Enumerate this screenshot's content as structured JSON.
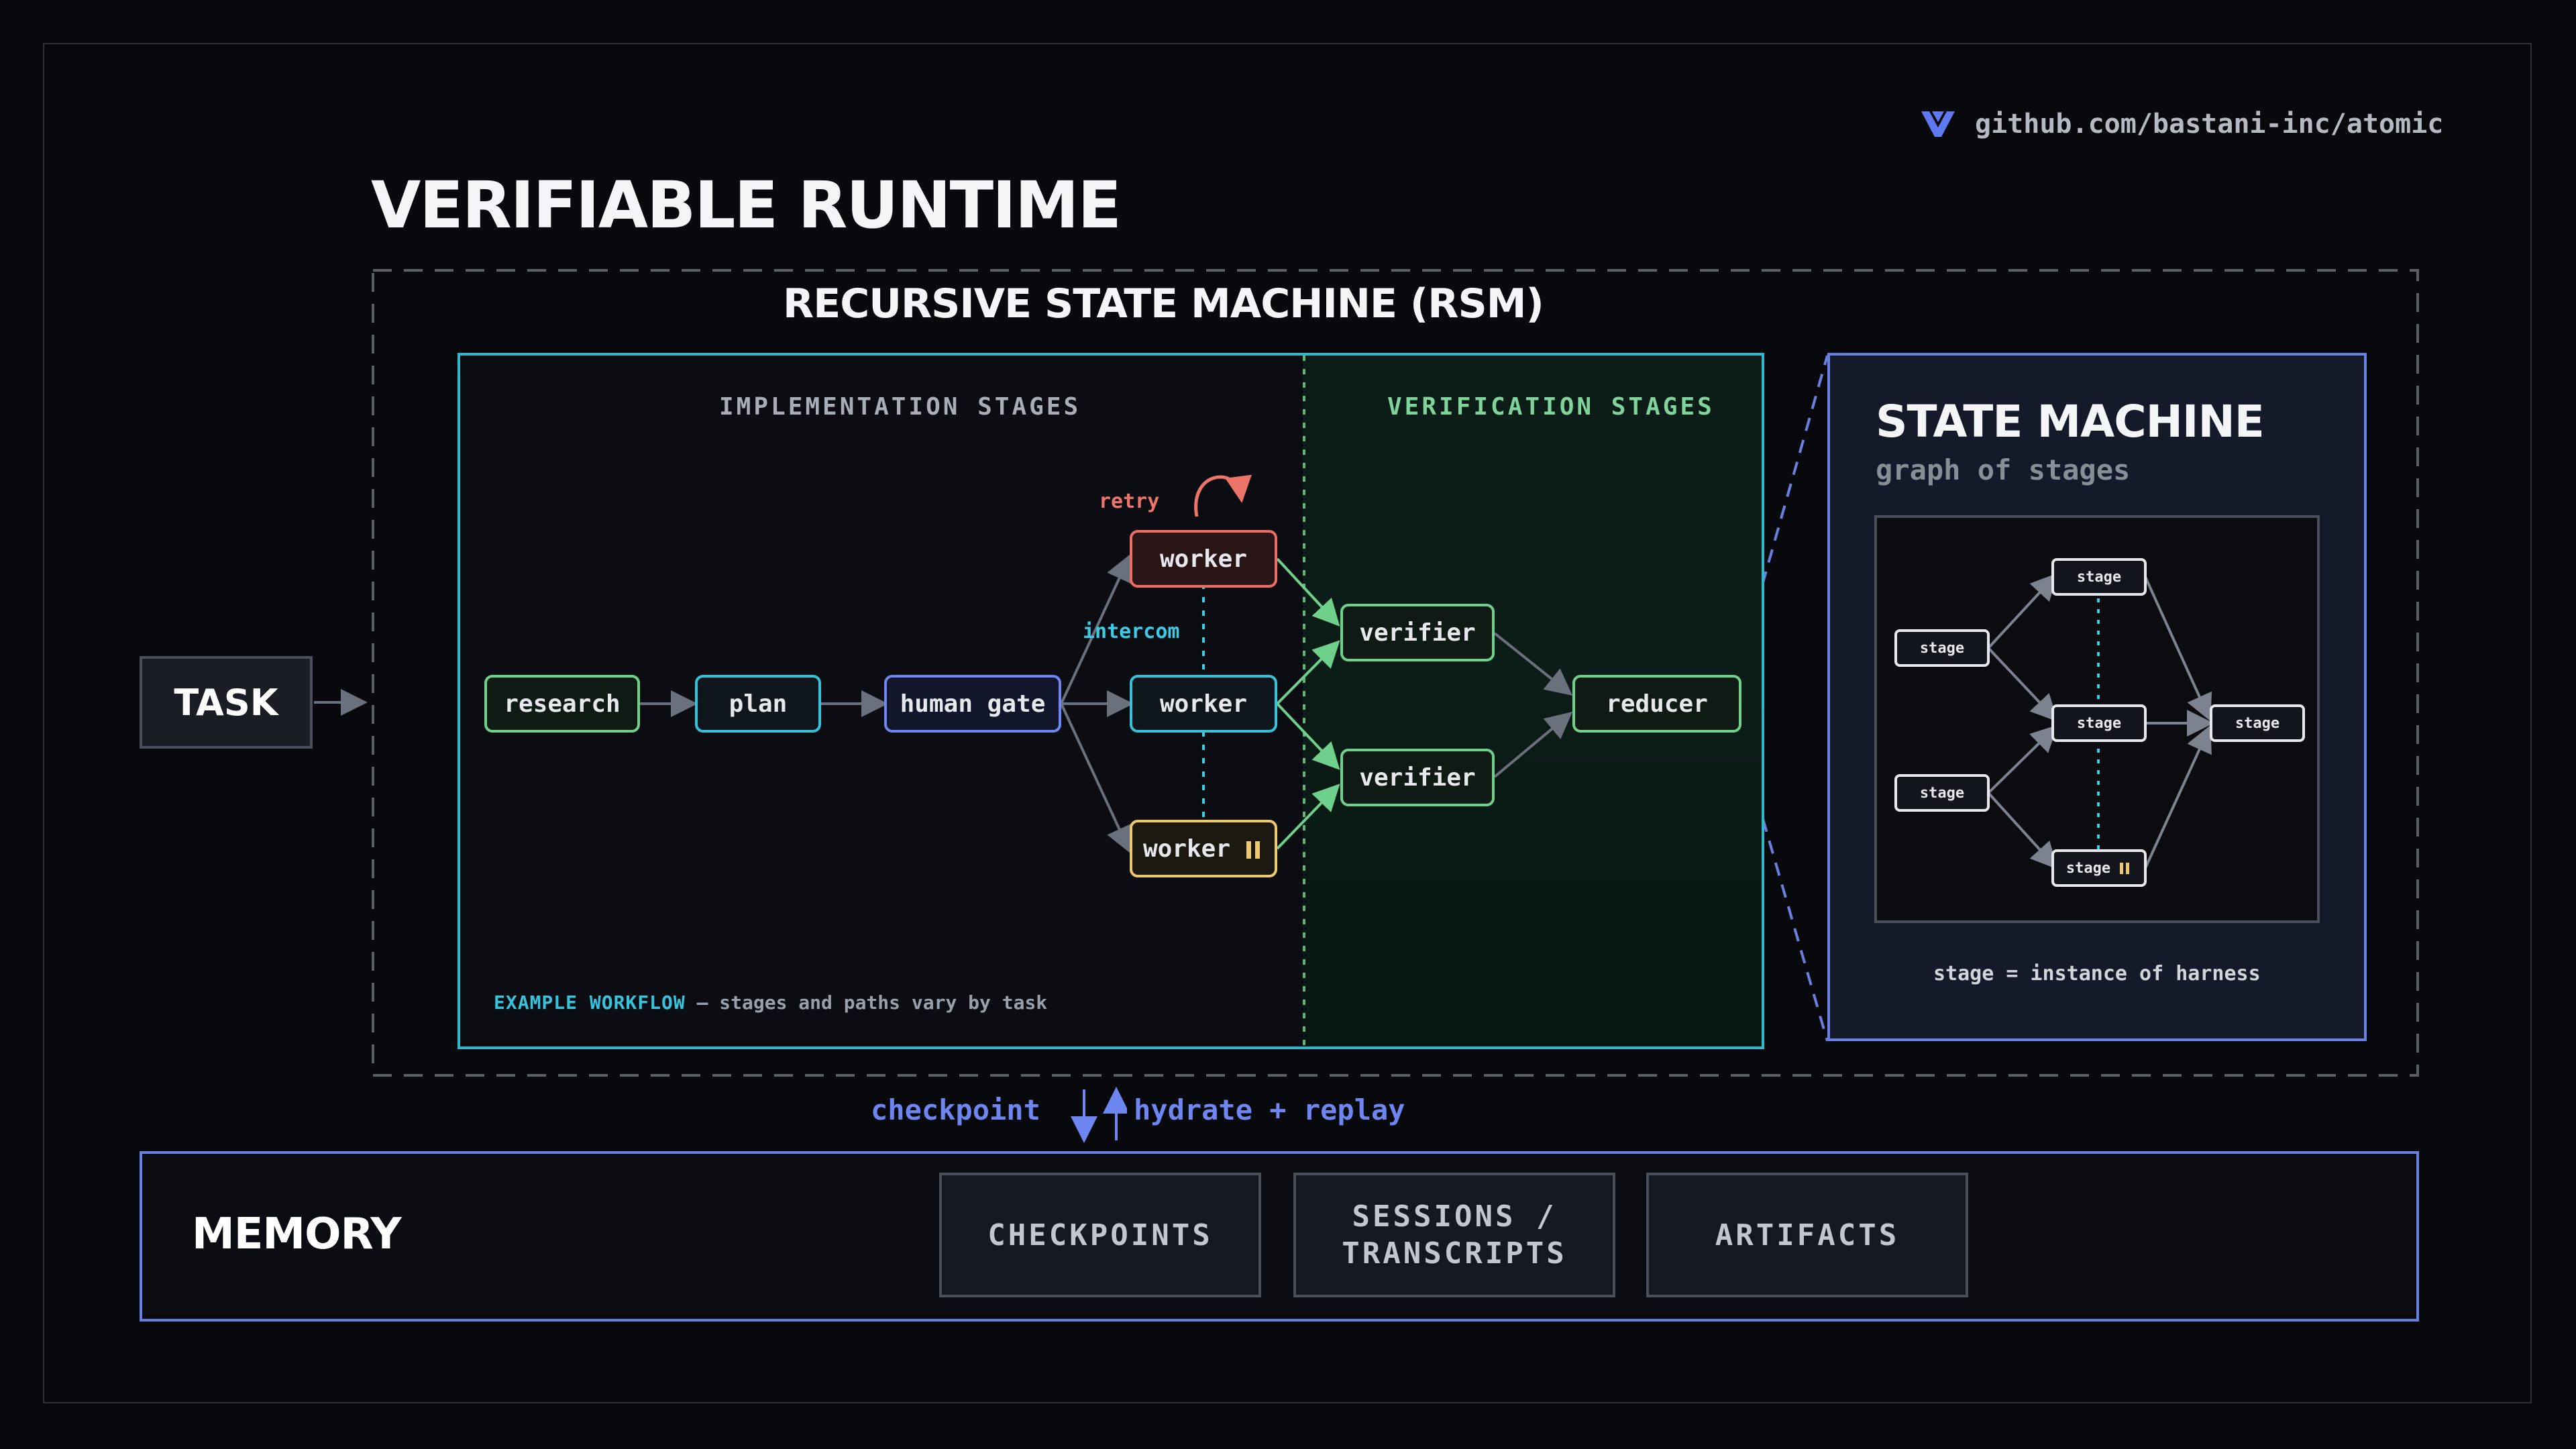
{
  "github": {
    "text": "github.com/bastani-inc/atomic",
    "icon": "atomic-logo-icon"
  },
  "title": "VERIFIABLE RUNTIME",
  "rsm": {
    "title": "RECURSIVE STATE MACHINE (RSM)"
  },
  "task": {
    "label": "TASK"
  },
  "implementation": {
    "label": "IMPLEMENTATION STAGES",
    "nodes": {
      "research": "research",
      "plan": "plan",
      "human_gate": "human gate",
      "worker_top": "worker",
      "worker_mid": "worker",
      "worker_bottom": "worker"
    },
    "retry_label": "retry",
    "intercom_label": "intercom"
  },
  "verification": {
    "label": "VERIFICATION STAGES",
    "nodes": {
      "verifier_top": "verifier",
      "verifier_bottom": "verifier",
      "reducer": "reducer"
    }
  },
  "footnote": {
    "highlight": "EXAMPLE WORKFLOW",
    "rest": " — stages and paths vary by task"
  },
  "state_machine": {
    "title": "STATE MACHINE",
    "subtitle": "graph of stages",
    "node_label": "stage",
    "caption": "stage = instance of harness"
  },
  "memory_flow": {
    "checkpoint": "checkpoint",
    "hydrate": "hydrate + replay"
  },
  "memory": {
    "label": "MEMORY",
    "cards": [
      "CHECKPOINTS",
      "SESSIONS /\nTRANSCRIPTS",
      "ARTIFACTS"
    ]
  },
  "colors": {
    "green": "#6fd08c",
    "cyan": "#37c1d8",
    "blue": "#6f86f0",
    "red": "#ea6e63",
    "yellow": "#eec86e",
    "gray": "#6b717c"
  }
}
